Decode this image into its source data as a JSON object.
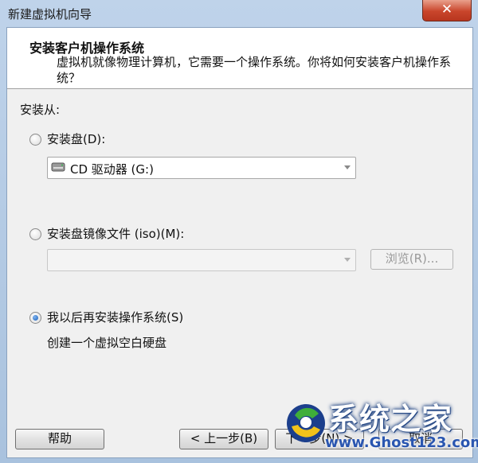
{
  "window": {
    "title": "新建虚拟机向导",
    "close_label": "✕"
  },
  "header": {
    "title": "安装客户机操作系统",
    "subtitle": "虚拟机就像物理计算机，它需要一个操作系统。你将如何安装客户机操作系统？"
  },
  "install_from": {
    "label": "安装从:",
    "disc": {
      "label": "安装盘(D):",
      "selected": false,
      "drive_value": "CD 驱动器 (G:)"
    },
    "iso": {
      "label": "安装盘镜像文件 (iso)(M):",
      "selected": false,
      "path_value": "",
      "browse_label": "浏览(R)..."
    },
    "later": {
      "label": "我以后再安装操作系统(S)",
      "selected": true,
      "description": "创建一个虚拟空白硬盘"
    }
  },
  "buttons": {
    "help": "帮助",
    "back": "< 上一步(B)",
    "next": "下一步(N) >",
    "cancel": "取消"
  },
  "watermark": {
    "text": "系统之家",
    "url": "www.Ghost123.com"
  },
  "colors": {
    "accent": "#1b5fb8",
    "close": "#c9452b",
    "watermark_url": "#2a56b0"
  }
}
